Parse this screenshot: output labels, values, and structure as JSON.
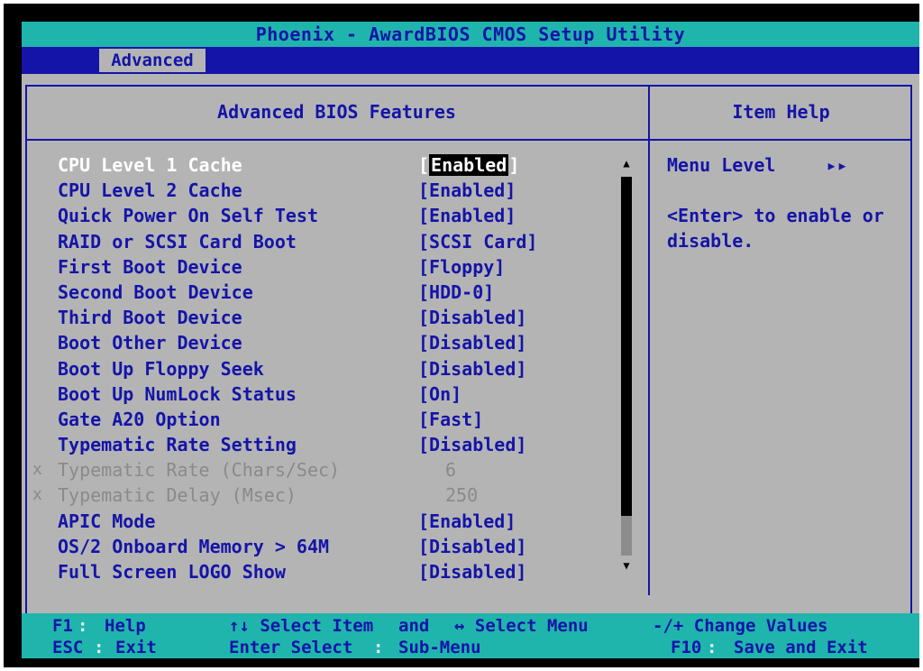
{
  "title": "Phoenix - AwardBIOS CMOS Setup Utility",
  "menu": {
    "active_tab": "Advanced"
  },
  "panel": {
    "title": "Advanced BIOS Features",
    "help_title": "Item Help"
  },
  "settings": [
    {
      "label": "CPU Level 1 Cache",
      "value": "Enabled",
      "state": "selected"
    },
    {
      "label": "CPU Level 2 Cache",
      "value": "[Enabled]",
      "state": "normal"
    },
    {
      "label": "Quick Power On Self Test",
      "value": "[Enabled]",
      "state": "normal"
    },
    {
      "label": "RAID or SCSI Card Boot",
      "value": "[SCSI Card]",
      "state": "normal"
    },
    {
      "label": "First Boot Device",
      "value": "[Floppy]",
      "state": "normal"
    },
    {
      "label": "Second Boot Device",
      "value": "[HDD-0]",
      "state": "normal"
    },
    {
      "label": "Third Boot Device",
      "value": "[Disabled]",
      "state": "normal"
    },
    {
      "label": "Boot Other Device",
      "value": "[Disabled]",
      "state": "normal"
    },
    {
      "label": "Boot Up Floppy Seek",
      "value": "[Disabled]",
      "state": "normal"
    },
    {
      "label": "Boot Up NumLock Status",
      "value": "[On]",
      "state": "normal"
    },
    {
      "label": "Gate A20 Option",
      "value": "[Fast]",
      "state": "normal"
    },
    {
      "label": "Typematic Rate Setting",
      "value": "[Disabled]",
      "state": "normal"
    },
    {
      "label": "Typematic Rate (Chars/Sec)",
      "value": "6",
      "state": "disabled"
    },
    {
      "label": "Typematic Delay (Msec)",
      "value": "250",
      "state": "disabled"
    },
    {
      "label": "APIC Mode",
      "value": "[Enabled]",
      "state": "normal"
    },
    {
      "label": "OS/2 Onboard Memory > 64M",
      "value": "[Disabled]",
      "state": "normal"
    },
    {
      "label": "Full Screen LOGO Show",
      "value": "[Disabled]",
      "state": "normal"
    }
  ],
  "selected_bracket_left": "[",
  "selected_bracket_right": "]",
  "disabled_marker": "x",
  "help": {
    "menu_level_label": "Menu Level",
    "menu_level_glyph": "▸▸",
    "line1": "<Enter> to enable or",
    "line2": "disable."
  },
  "scroll": {
    "up_glyph": "▲",
    "down_glyph": "▼"
  },
  "footer": {
    "f1_key": "F1",
    "f1_label": "Help",
    "esc_key": "ESC",
    "esc_label": "Exit",
    "select_item": "↑↓ Select Item",
    "and": "and",
    "select_menu": "↔ Select Menu",
    "enter_select": "Enter Select",
    "sub_menu": "Sub-Menu",
    "change_values": "-/+ Change Values",
    "f10_key": "F10",
    "f10_label": "Save and Exit",
    "sep": ":"
  },
  "colors": {
    "bios_blue": "#1414a8",
    "teal": "#1fb5ad",
    "gray": "#b4b4b4",
    "dim": "#8a8a8a"
  }
}
